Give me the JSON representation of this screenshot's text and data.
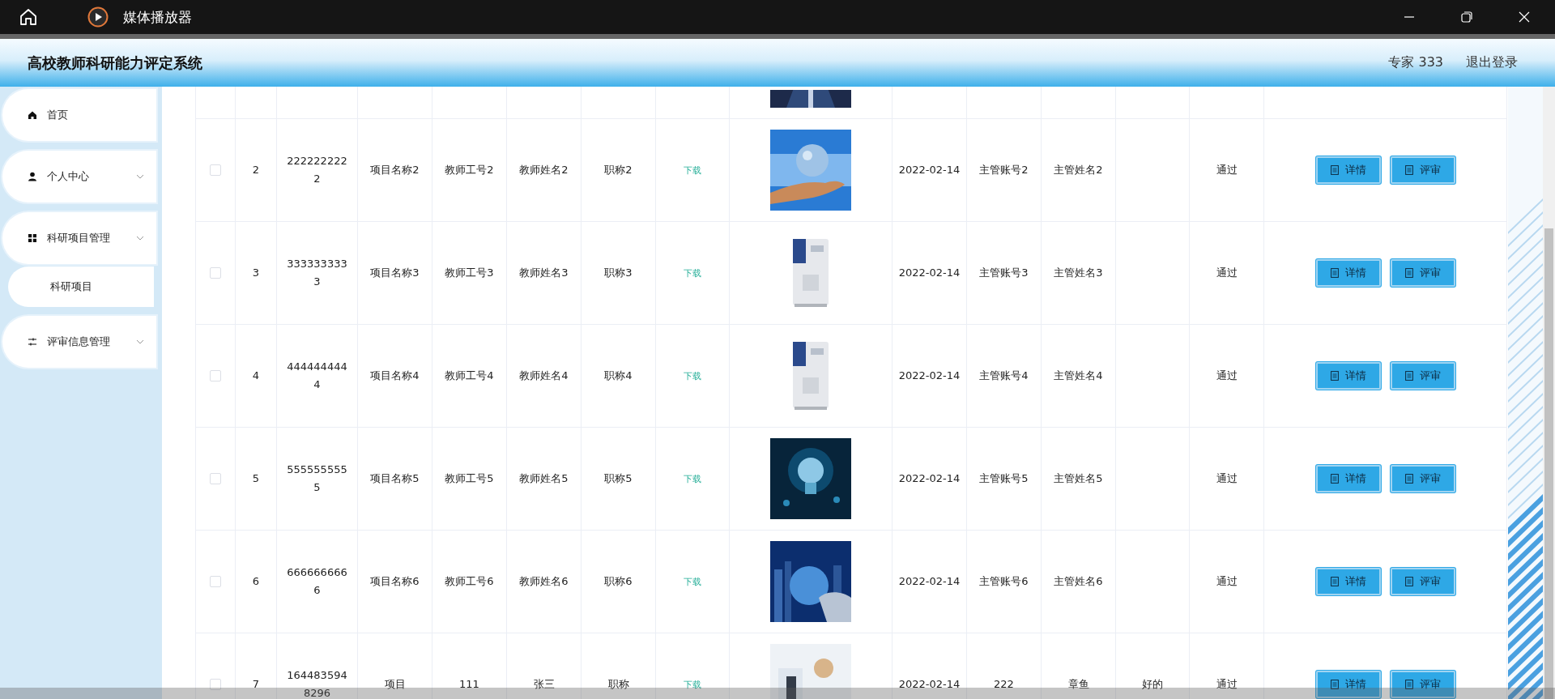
{
  "titlebar": {
    "app_name": "媒体播放器"
  },
  "header": {
    "title": "高校教师科研能力评定系统",
    "user": "专家 333",
    "logout": "退出登录"
  },
  "sidebar": {
    "items": [
      {
        "label": "首页",
        "kind": "menu",
        "expandable": false
      },
      {
        "label": "个人中心",
        "kind": "menu",
        "expandable": true
      },
      {
        "label": "科研项目管理",
        "kind": "menu",
        "expandable": true
      },
      {
        "label": "科研项目",
        "kind": "submenu"
      },
      {
        "label": "评审信息管理",
        "kind": "menu",
        "expandable": true
      }
    ]
  },
  "table": {
    "rows": [
      {
        "image": {
          "kind": "picture"
        }
      },
      {
        "selected": false,
        "index": "2",
        "number": "2222222222",
        "name": "项目名称2",
        "teacher_id": "教师工号2",
        "teacher_name": "教师姓名2",
        "title": "职称2",
        "file": "下载",
        "image": {
          "kind": "picture"
        },
        "date": "2022-02-14",
        "manager_id": "主管账号2",
        "manager_name": "主管姓名2",
        "status": "通过",
        "actions": [
          "详情",
          "评审"
        ]
      },
      {
        "selected": false,
        "index": "3",
        "number": "3333333333",
        "name": "项目名称3",
        "teacher_id": "教师工号3",
        "teacher_name": "教师姓名3",
        "title": "职称3",
        "file": "下载",
        "image": {
          "kind": "picture"
        },
        "date": "2022-02-14",
        "manager_id": "主管账号3",
        "manager_name": "主管姓名3",
        "status": "通过",
        "actions": [
          "详情",
          "评审"
        ]
      },
      {
        "selected": false,
        "index": "4",
        "number": "4444444444",
        "name": "项目名称4",
        "teacher_id": "教师工号4",
        "teacher_name": "教师姓名4",
        "title": "职称4",
        "file": "下载",
        "image": {
          "kind": "picture"
        },
        "date": "2022-02-14",
        "manager_id": "主管账号4",
        "manager_name": "主管姓名4",
        "status": "通过",
        "actions": [
          "详情",
          "评审"
        ]
      },
      {
        "selected": false,
        "index": "5",
        "number": "5555555555",
        "name": "项目名称5",
        "teacher_id": "教师工号5",
        "teacher_name": "教师姓名5",
        "title": "职称5",
        "file": "下载",
        "image": {
          "kind": "picture"
        },
        "date": "2022-02-14",
        "manager_id": "主管账号5",
        "manager_name": "主管姓名5",
        "status": "通过",
        "actions": [
          "详情",
          "评审"
        ]
      },
      {
        "selected": false,
        "index": "6",
        "number": "6666666666",
        "name": "项目名称6",
        "teacher_id": "教师工号6",
        "teacher_name": "教师姓名6",
        "title": "职称6",
        "file": "下载",
        "image": {
          "kind": "picture"
        },
        "date": "2022-02-14",
        "manager_id": "主管账号6",
        "manager_name": "主管姓名6",
        "status": "通过",
        "actions": [
          "详情",
          "评审"
        ]
      },
      {
        "selected": false,
        "index": "7",
        "number": "1644835948296",
        "name": "项目",
        "teacher_id": "111",
        "teacher_name": "张三",
        "title": "职称",
        "file": "下载",
        "image": {
          "kind": "picture"
        },
        "date": "2022-02-14",
        "manager_id": "222",
        "manager_name": "章鱼",
        "comment": "好的",
        "status": "通过",
        "actions": [
          "详情",
          "评审"
        ]
      }
    ]
  }
}
